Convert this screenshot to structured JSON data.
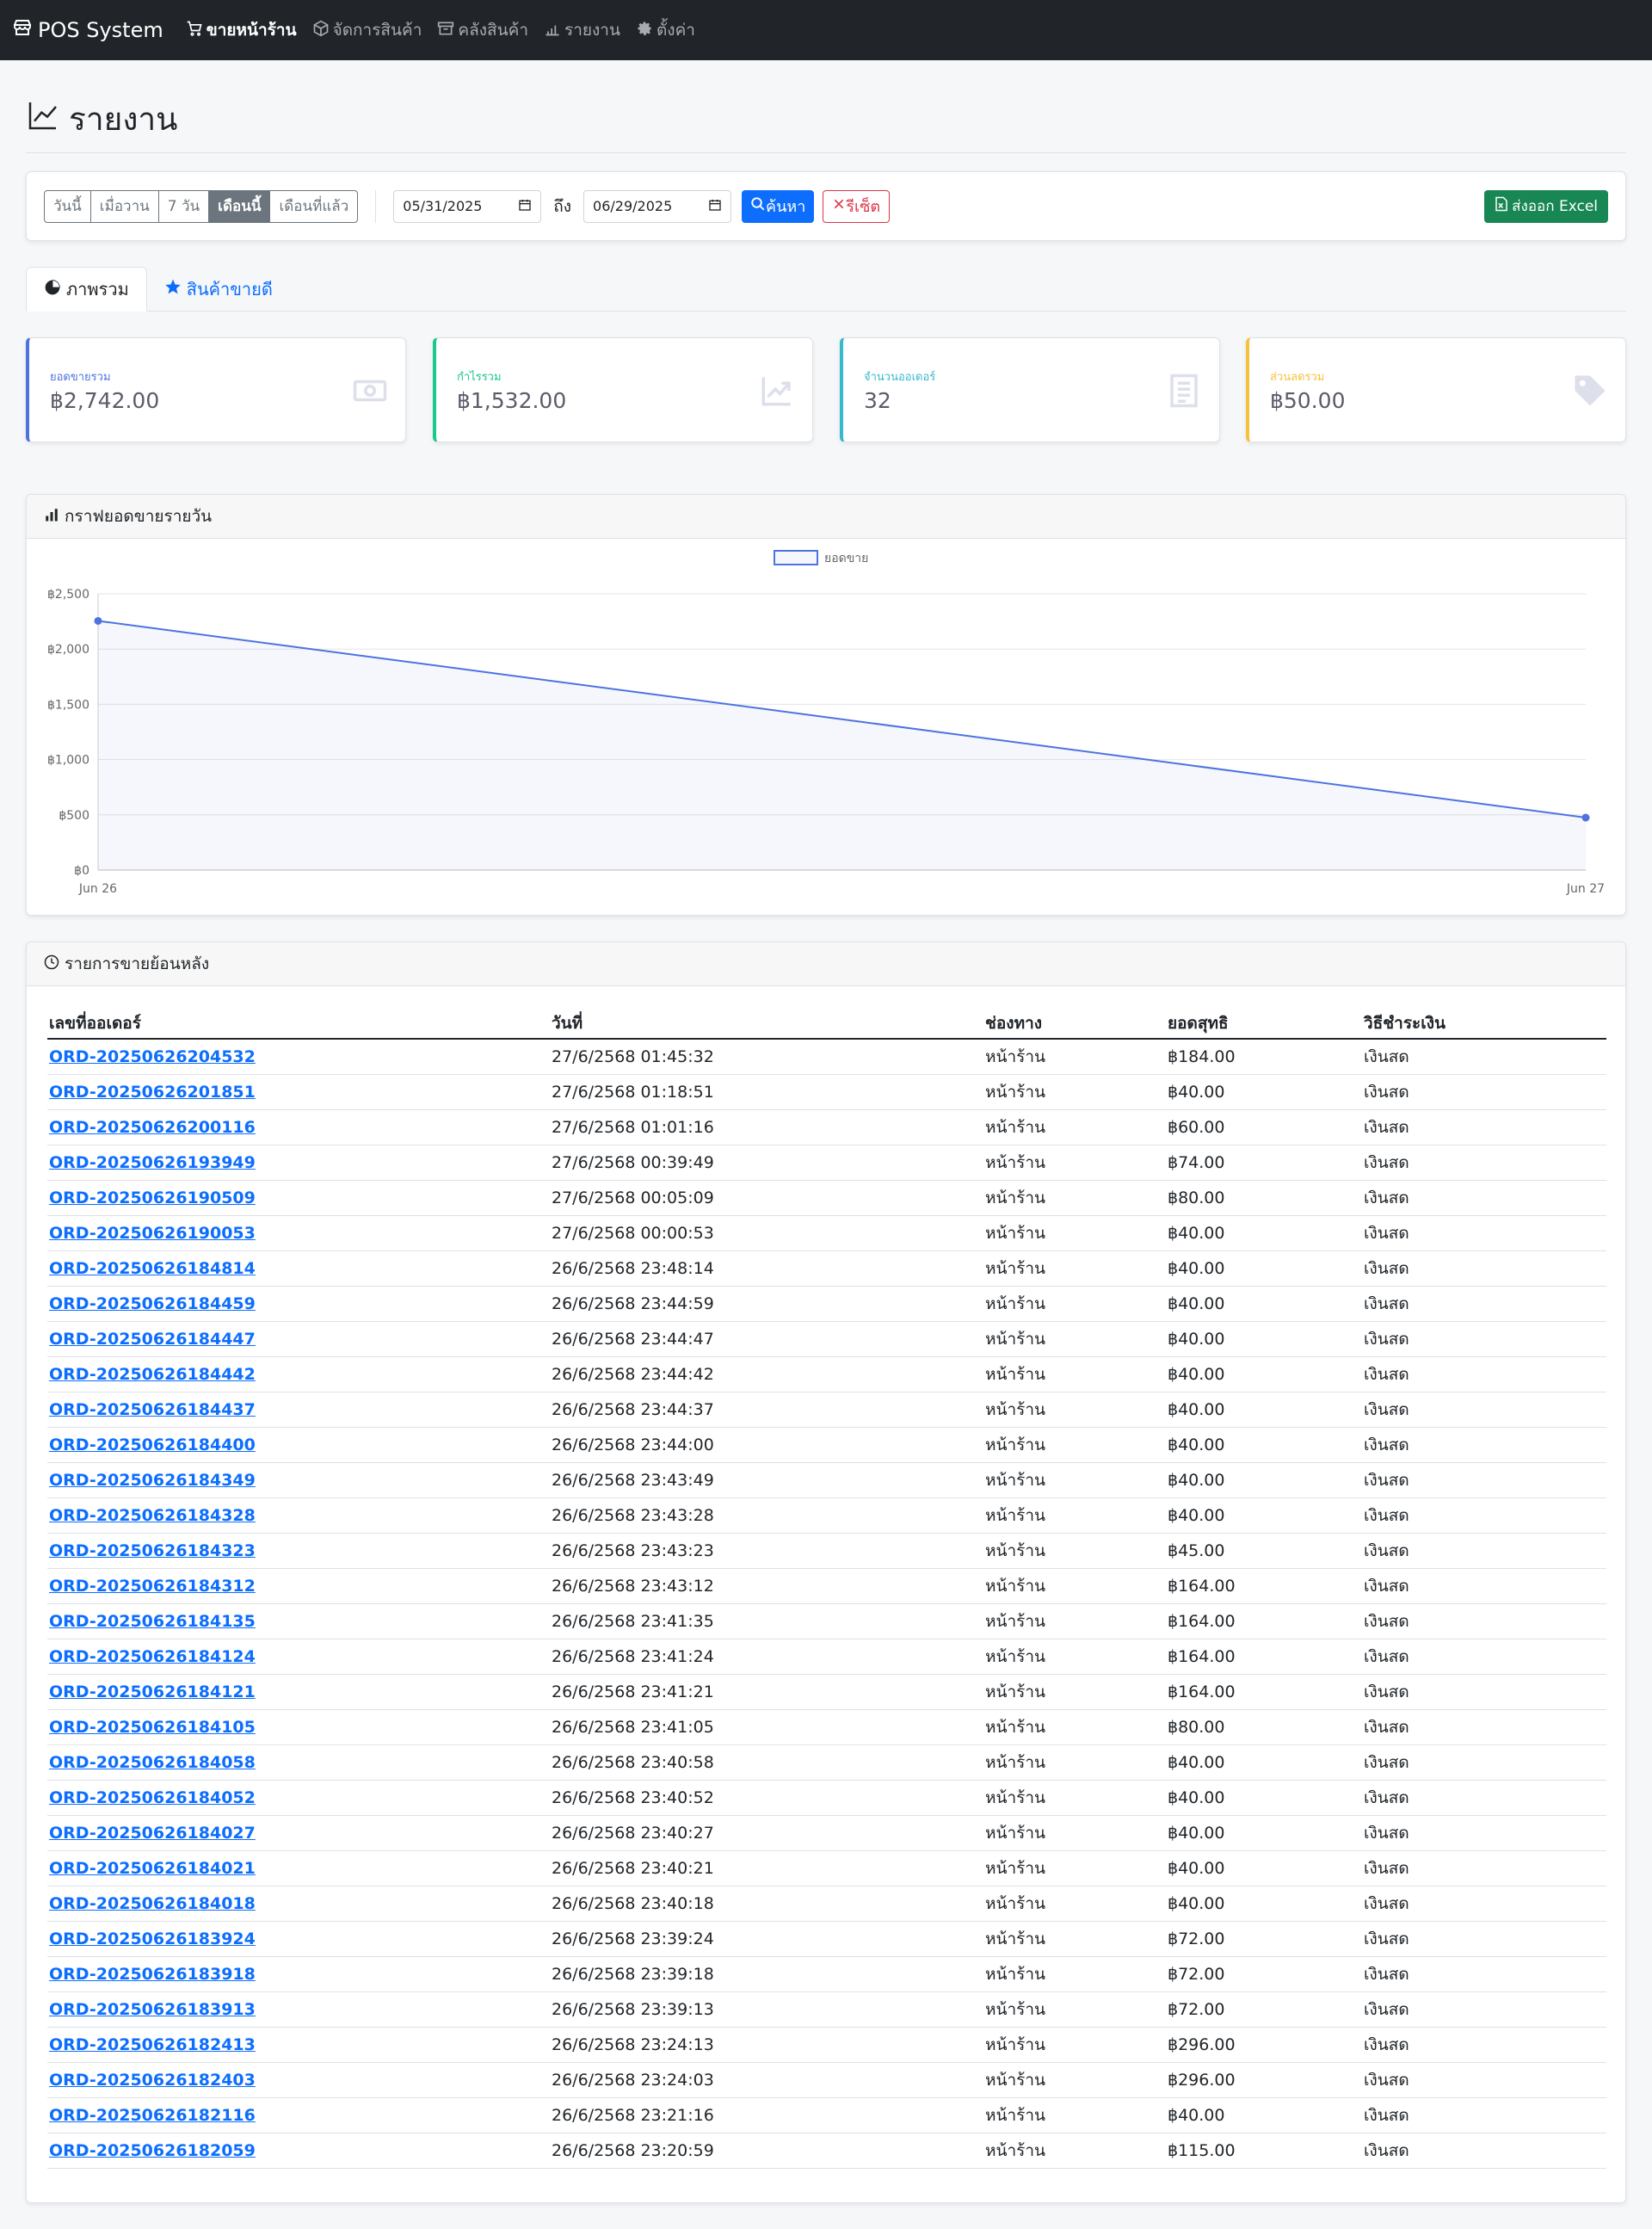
{
  "nav": {
    "brand": "POS System",
    "items": [
      {
        "label": "ขายหน้าร้าน",
        "icon": "cart-icon",
        "active": true
      },
      {
        "label": "จัดการสินค้า",
        "icon": "box-icon",
        "active": false
      },
      {
        "label": "คลังสินค้า",
        "icon": "archive-icon",
        "active": false
      },
      {
        "label": "รายงาน",
        "icon": "bar-chart-icon",
        "active": false
      },
      {
        "label": "ตั้งค่า",
        "icon": "gear-icon",
        "active": false
      }
    ]
  },
  "page": {
    "title": "รายงาน"
  },
  "filter": {
    "ranges": [
      "วันนี้",
      "เมื่อวาน",
      "7 วัน",
      "เดือนนี้",
      "เดือนที่แล้ว"
    ],
    "active_range": "เดือนนี้",
    "start_date": "05/31/2025",
    "to_label": "ถึง",
    "end_date": "06/29/2025",
    "search_label": "ค้นหา",
    "reset_label": "รีเซ็ต",
    "export_label": "ส่งออก Excel"
  },
  "tabs": [
    {
      "label": "ภาพรวม",
      "icon": "pie-chart-icon",
      "active": true
    },
    {
      "label": "สินค้าขายดี",
      "icon": "star-icon",
      "active": false
    }
  ],
  "stats": [
    {
      "label": "ยอดขายรวม",
      "value": "฿2,742.00",
      "color": "#4e73df",
      "icon": "cash-icon"
    },
    {
      "label": "กำไรรวม",
      "value": "฿1,532.00",
      "color": "#1cc88a",
      "icon": "trend-up-icon"
    },
    {
      "label": "จำนวนออเดอร์",
      "value": "32",
      "color": "#36b9cc",
      "icon": "receipt-icon"
    },
    {
      "label": "ส่วนลดรวม",
      "value": "฿50.00",
      "color": "#f6c23e",
      "icon": "tag-icon"
    }
  ],
  "chart_card": {
    "title": "กราฟยอดขายรายวัน"
  },
  "chart_data": {
    "type": "line",
    "x": [
      "Jun 26",
      "Jun 27"
    ],
    "series": [
      {
        "name": "ยอดขาย",
        "values": [
          2255,
          475
        ]
      }
    ],
    "ylim": [
      0,
      2500
    ],
    "yticks": [
      "฿0",
      "฿500",
      "฿1,000",
      "฿1,500",
      "฿2,000",
      "฿2,500"
    ],
    "legend": "top",
    "grid": true,
    "color": "#4e73df"
  },
  "table_card": {
    "title": "รายการขายย้อนหลัง",
    "headers": [
      "เลขที่ออเดอร์",
      "วันที่",
      "ช่องทาง",
      "ยอดสุทธิ",
      "วิธีชำระเงิน"
    ],
    "rows": [
      [
        "ORD-20250626204532",
        "27/6/2568 01:45:32",
        "หน้าร้าน",
        "฿184.00",
        "เงินสด"
      ],
      [
        "ORD-20250626201851",
        "27/6/2568 01:18:51",
        "หน้าร้าน",
        "฿40.00",
        "เงินสด"
      ],
      [
        "ORD-20250626200116",
        "27/6/2568 01:01:16",
        "หน้าร้าน",
        "฿60.00",
        "เงินสด"
      ],
      [
        "ORD-20250626193949",
        "27/6/2568 00:39:49",
        "หน้าร้าน",
        "฿74.00",
        "เงินสด"
      ],
      [
        "ORD-20250626190509",
        "27/6/2568 00:05:09",
        "หน้าร้าน",
        "฿80.00",
        "เงินสด"
      ],
      [
        "ORD-20250626190053",
        "27/6/2568 00:00:53",
        "หน้าร้าน",
        "฿40.00",
        "เงินสด"
      ],
      [
        "ORD-20250626184814",
        "26/6/2568 23:48:14",
        "หน้าร้าน",
        "฿40.00",
        "เงินสด"
      ],
      [
        "ORD-20250626184459",
        "26/6/2568 23:44:59",
        "หน้าร้าน",
        "฿40.00",
        "เงินสด"
      ],
      [
        "ORD-20250626184447",
        "26/6/2568 23:44:47",
        "หน้าร้าน",
        "฿40.00",
        "เงินสด"
      ],
      [
        "ORD-20250626184442",
        "26/6/2568 23:44:42",
        "หน้าร้าน",
        "฿40.00",
        "เงินสด"
      ],
      [
        "ORD-20250626184437",
        "26/6/2568 23:44:37",
        "หน้าร้าน",
        "฿40.00",
        "เงินสด"
      ],
      [
        "ORD-20250626184400",
        "26/6/2568 23:44:00",
        "หน้าร้าน",
        "฿40.00",
        "เงินสด"
      ],
      [
        "ORD-20250626184349",
        "26/6/2568 23:43:49",
        "หน้าร้าน",
        "฿40.00",
        "เงินสด"
      ],
      [
        "ORD-20250626184328",
        "26/6/2568 23:43:28",
        "หน้าร้าน",
        "฿40.00",
        "เงินสด"
      ],
      [
        "ORD-20250626184323",
        "26/6/2568 23:43:23",
        "หน้าร้าน",
        "฿45.00",
        "เงินสด"
      ],
      [
        "ORD-20250626184312",
        "26/6/2568 23:43:12",
        "หน้าร้าน",
        "฿164.00",
        "เงินสด"
      ],
      [
        "ORD-20250626184135",
        "26/6/2568 23:41:35",
        "หน้าร้าน",
        "฿164.00",
        "เงินสด"
      ],
      [
        "ORD-20250626184124",
        "26/6/2568 23:41:24",
        "หน้าร้าน",
        "฿164.00",
        "เงินสด"
      ],
      [
        "ORD-20250626184121",
        "26/6/2568 23:41:21",
        "หน้าร้าน",
        "฿164.00",
        "เงินสด"
      ],
      [
        "ORD-20250626184105",
        "26/6/2568 23:41:05",
        "หน้าร้าน",
        "฿80.00",
        "เงินสด"
      ],
      [
        "ORD-20250626184058",
        "26/6/2568 23:40:58",
        "หน้าร้าน",
        "฿40.00",
        "เงินสด"
      ],
      [
        "ORD-20250626184052",
        "26/6/2568 23:40:52",
        "หน้าร้าน",
        "฿40.00",
        "เงินสด"
      ],
      [
        "ORD-20250626184027",
        "26/6/2568 23:40:27",
        "หน้าร้าน",
        "฿40.00",
        "เงินสด"
      ],
      [
        "ORD-20250626184021",
        "26/6/2568 23:40:21",
        "หน้าร้าน",
        "฿40.00",
        "เงินสด"
      ],
      [
        "ORD-20250626184018",
        "26/6/2568 23:40:18",
        "หน้าร้าน",
        "฿40.00",
        "เงินสด"
      ],
      [
        "ORD-20250626183924",
        "26/6/2568 23:39:24",
        "หน้าร้าน",
        "฿72.00",
        "เงินสด"
      ],
      [
        "ORD-20250626183918",
        "26/6/2568 23:39:18",
        "หน้าร้าน",
        "฿72.00",
        "เงินสด"
      ],
      [
        "ORD-20250626183913",
        "26/6/2568 23:39:13",
        "หน้าร้าน",
        "฿72.00",
        "เงินสด"
      ],
      [
        "ORD-20250626182413",
        "26/6/2568 23:24:13",
        "หน้าร้าน",
        "฿296.00",
        "เงินสด"
      ],
      [
        "ORD-20250626182403",
        "26/6/2568 23:24:03",
        "หน้าร้าน",
        "฿296.00",
        "เงินสด"
      ],
      [
        "ORD-20250626182116",
        "26/6/2568 23:21:16",
        "หน้าร้าน",
        "฿40.00",
        "เงินสด"
      ],
      [
        "ORD-20250626182059",
        "26/6/2568 23:20:59",
        "หน้าร้าน",
        "฿115.00",
        "เงินสด"
      ]
    ]
  }
}
